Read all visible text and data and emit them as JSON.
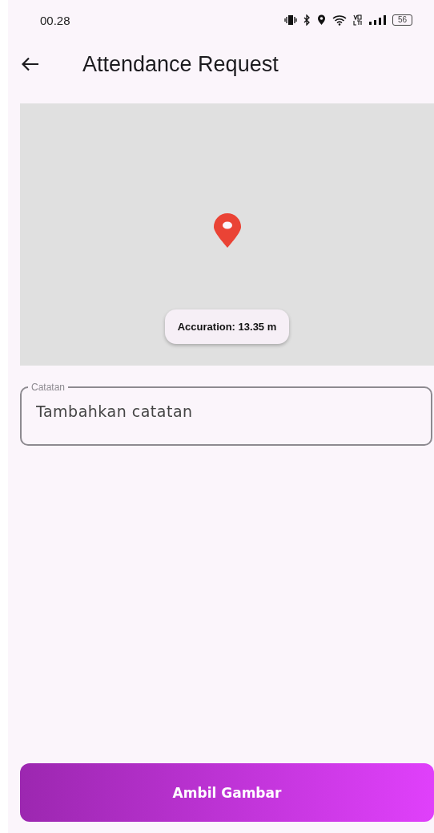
{
  "status_bar": {
    "time": "00.28",
    "battery": "56"
  },
  "app_bar": {
    "title": "Attendance Request"
  },
  "map": {
    "accuracy": "Accuration: 13.35 m"
  },
  "note_field": {
    "label": "Catatan",
    "placeholder": "Tambahkan catatan"
  },
  "primary_button": {
    "label": "Ambil Gambar"
  }
}
